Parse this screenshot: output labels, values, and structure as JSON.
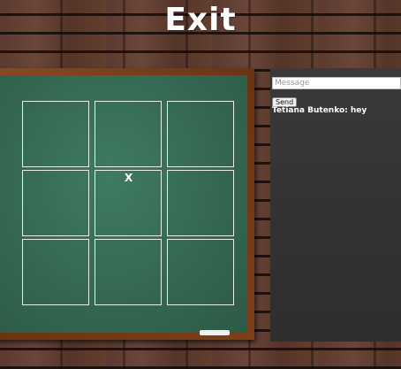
{
  "header": {
    "exit_label": "Exit"
  },
  "board": {
    "cells": [
      "",
      "",
      "",
      "",
      "X",
      "",
      "",
      "",
      ""
    ]
  },
  "chat": {
    "input_placeholder": "Message",
    "send_label": "Send",
    "messages": [
      {
        "author": "Tetiana Butenko",
        "text": "hey"
      }
    ]
  }
}
